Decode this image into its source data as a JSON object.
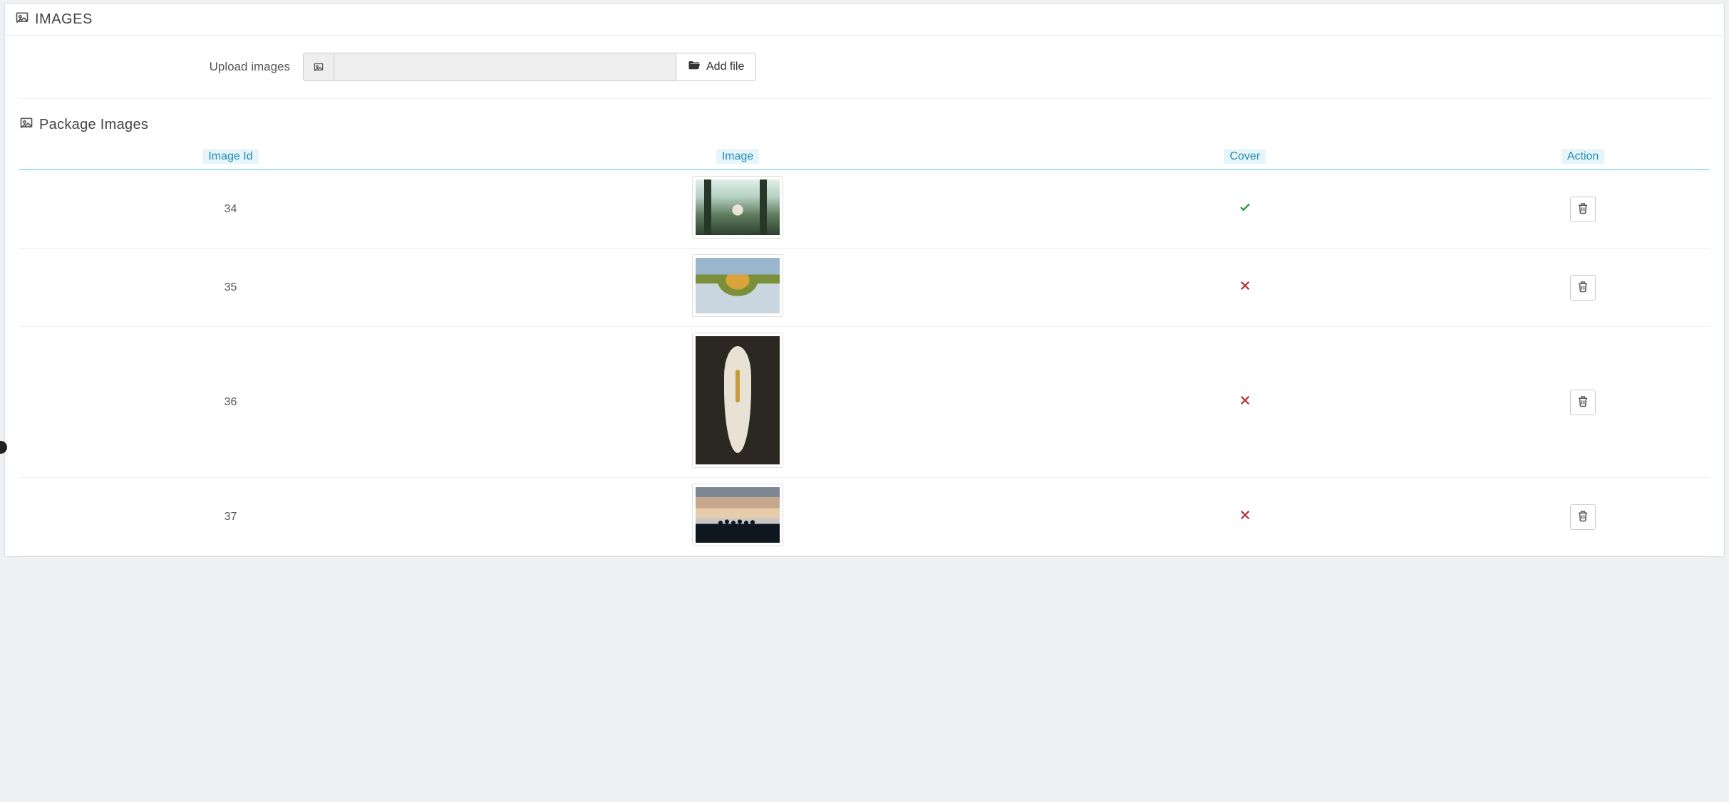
{
  "panel": {
    "title": "IMAGES",
    "upload_label": "Upload images",
    "add_file_label": "Add file",
    "sub_title": "Package Images"
  },
  "table": {
    "headers": {
      "image_id": "Image Id",
      "image": "Image",
      "cover": "Cover",
      "action": "Action"
    },
    "rows": [
      {
        "id": "34",
        "is_cover": true,
        "orientation": "landscape",
        "art": "forest"
      },
      {
        "id": "35",
        "is_cover": false,
        "orientation": "landscape",
        "art": "lake"
      },
      {
        "id": "36",
        "is_cover": false,
        "orientation": "portrait",
        "art": "boat"
      },
      {
        "id": "37",
        "is_cover": false,
        "orientation": "landscape",
        "art": "sunset"
      }
    ]
  },
  "icons": {
    "cover_true": "✓",
    "cover_false": "✕"
  }
}
